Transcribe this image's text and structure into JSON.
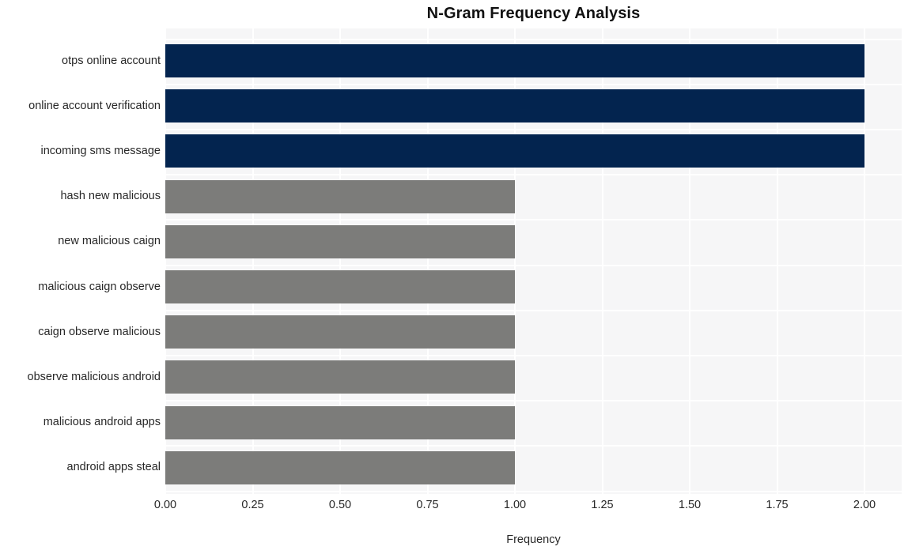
{
  "chart_data": {
    "type": "bar",
    "orientation": "horizontal",
    "title": "N-Gram Frequency Analysis",
    "xlabel": "Frequency",
    "ylabel": "",
    "xlim": [
      0.0,
      2.0
    ],
    "xticks": [
      "0.00",
      "0.25",
      "0.50",
      "0.75",
      "1.00",
      "1.25",
      "1.50",
      "1.75",
      "2.00"
    ],
    "xtick_values": [
      0.0,
      0.25,
      0.5,
      0.75,
      1.0,
      1.25,
      1.5,
      1.75,
      2.0
    ],
    "grid": true,
    "legend": "none",
    "categories": [
      "otps online account",
      "online account verification",
      "incoming sms message",
      "hash new malicious",
      "new malicious caign",
      "malicious caign observe",
      "caign observe malicious",
      "observe malicious android",
      "malicious android apps",
      "android apps steal"
    ],
    "values": [
      2,
      2,
      2,
      1,
      1,
      1,
      1,
      1,
      1,
      1
    ],
    "bar_colors": [
      "#03244f",
      "#03244f",
      "#03244f",
      "#7c7c7a",
      "#7c7c7a",
      "#7c7c7a",
      "#7c7c7a",
      "#7c7c7a",
      "#7c7c7a",
      "#7c7c7a"
    ],
    "colors": {
      "highlight": "#03244f",
      "default": "#7c7c7a",
      "plot_background": "#f6f6f7",
      "gridline": "#ffffff",
      "figure_background": "#ffffff",
      "text": "#282828",
      "title_text": "#111111"
    }
  }
}
